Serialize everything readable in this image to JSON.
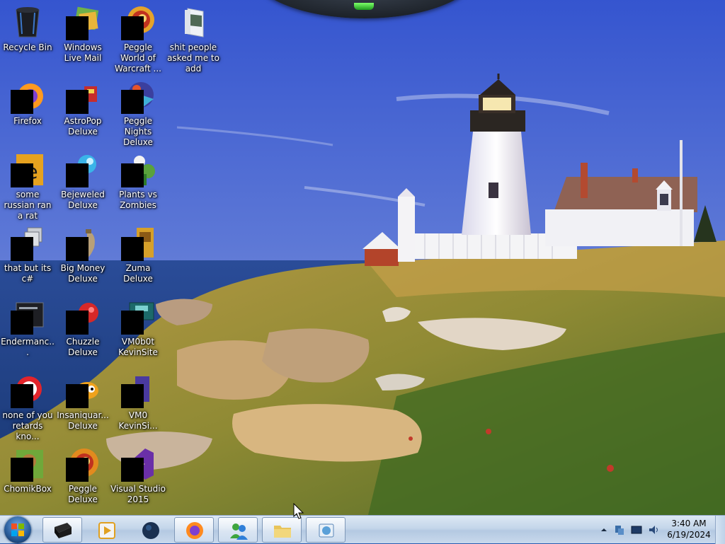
{
  "desktop": {
    "icons": [
      {
        "label": "Recycle Bin",
        "icon": "recycle-bin-icon"
      },
      {
        "label": "Windows Live Mail",
        "icon": "windows-live-mail-icon"
      },
      {
        "label": "Peggle World of Warcraft ...",
        "icon": "peggle-wow-icon"
      },
      {
        "label": "shit people asked me to add",
        "icon": "folder-icon"
      },
      {
        "label": "Firefox",
        "icon": "firefox-icon"
      },
      {
        "label": "AstroPop Deluxe",
        "icon": "astropop-icon"
      },
      {
        "label": "Peggle Nights Deluxe",
        "icon": "peggle-nights-icon"
      },
      {
        "label": "some russian ran a rat",
        "icon": "rat-program-icon"
      },
      {
        "label": "Bejeweled Deluxe",
        "icon": "bejeweled-icon"
      },
      {
        "label": "Plants vs Zombies",
        "icon": "plants-vs-zombies-icon"
      },
      {
        "label": "that but its c#",
        "icon": "stacked-windows-icon"
      },
      {
        "label": "Big Money Deluxe",
        "icon": "big-money-icon"
      },
      {
        "label": "Zuma Deluxe",
        "icon": "zuma-icon"
      },
      {
        "label": "Endermanc...",
        "icon": "terminal-app-icon"
      },
      {
        "label": "Chuzzle Deluxe",
        "icon": "chuzzle-icon"
      },
      {
        "label": "VM0b0t KevinSite",
        "icon": "vm-bot-icon"
      },
      {
        "label": "none of you retards kno...",
        "icon": "opera-icon"
      },
      {
        "label": "Insaniquar... Deluxe",
        "icon": "insaniquarium-icon"
      },
      {
        "label": "VM0 KevinSi...",
        "icon": "vm-app-icon"
      },
      {
        "label": "ChomikBox",
        "icon": "chomikbox-icon"
      },
      {
        "label": "Peggle Deluxe",
        "icon": "peggle-icon"
      },
      {
        "label": "Visual Studio 2015",
        "icon": "visual-studio-icon"
      }
    ]
  },
  "taskbar": {
    "pinned": [
      {
        "name": "start-button",
        "icon": "windows-logo-icon"
      },
      {
        "name": "black-app",
        "icon": "black-box-icon"
      },
      {
        "name": "media-player",
        "icon": "media-player-icon"
      },
      {
        "name": "globe-app",
        "icon": "globe-icon"
      },
      {
        "name": "firefox",
        "icon": "firefox-icon"
      },
      {
        "name": "messenger",
        "icon": "messenger-icon"
      },
      {
        "name": "file-explorer",
        "icon": "folder-icon"
      },
      {
        "name": "media-center",
        "icon": "media-center-icon"
      }
    ],
    "tray": [
      "chevron-up-icon",
      "network-icon",
      "display-icon",
      "volume-icon"
    ],
    "clock": {
      "time": "3:40 AM",
      "date": "6/19/2024"
    }
  },
  "colors": {
    "sky_top": "#3b5fd6",
    "sky_bottom": "#9fb2e4",
    "sea": "#1f3f8a",
    "grass": "#a08a2c",
    "taskbar": "#c9d9ec"
  }
}
